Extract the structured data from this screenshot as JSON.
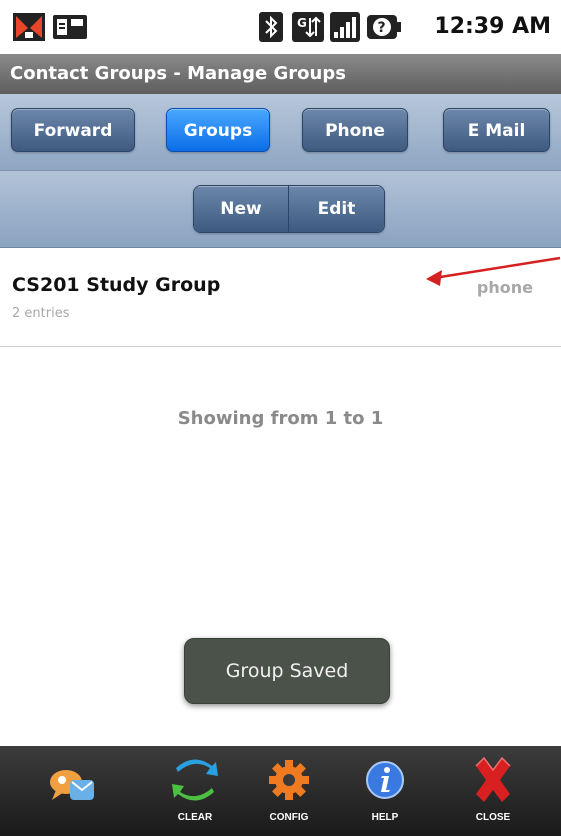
{
  "status_bar": {
    "time": "12:39 AM",
    "icons": [
      "app-notification-icon",
      "sd-card-icon",
      "bluetooth-icon",
      "data-transfer-icon",
      "signal-strength-icon",
      "battery-unknown-icon"
    ]
  },
  "title_bar": {
    "title": "Contact Groups - Manage Groups"
  },
  "tabs": [
    {
      "label": "Forward"
    },
    {
      "label": "Groups"
    },
    {
      "label": "Phone"
    },
    {
      "label": "E Mail"
    }
  ],
  "active_tab": "Groups",
  "actions": {
    "new_label": "New",
    "edit_label": "Edit"
  },
  "list": {
    "items": [
      {
        "title": "CS201 Study Group",
        "subtitle": "2 entries",
        "tag": "phone"
      }
    ]
  },
  "pager": {
    "text": "Showing from 1 to 1"
  },
  "toast": {
    "text": "Group Saved"
  },
  "toolbar": {
    "home_label": "",
    "clear_label": "CLEAR",
    "config_label": "CONFIG",
    "help_label": "HELP",
    "close_label": "CLOSE"
  },
  "colors": {
    "active_tab": "#0a6ee8",
    "tab": "#3e5a80",
    "annotation_arrow": "#d42020",
    "toast_bg": "#4b524a"
  }
}
